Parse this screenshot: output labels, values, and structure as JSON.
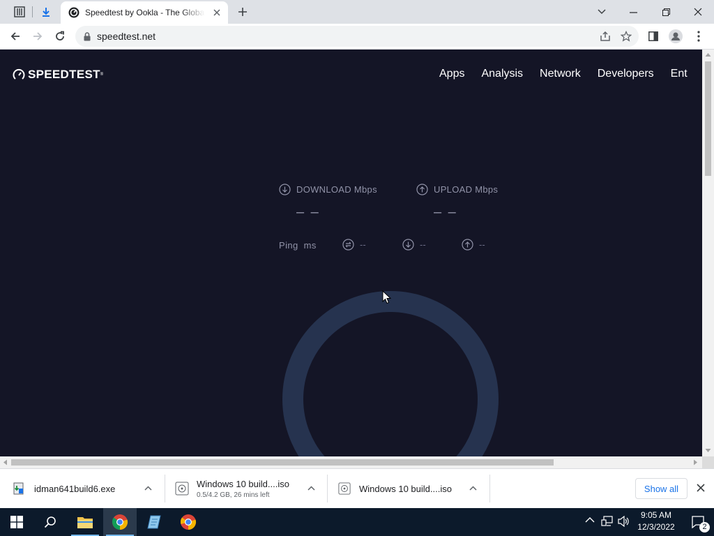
{
  "browser": {
    "tab_title": "Speedtest by Ookla - The Global Broadband Speed Test",
    "url": "speedtest.net"
  },
  "site": {
    "logo_text": "SPEEDTEST",
    "nav": [
      "Apps",
      "Analysis",
      "Network",
      "Developers",
      "Ent"
    ],
    "download": {
      "label": "DOWNLOAD",
      "unit": "Mbps",
      "value": "– –"
    },
    "upload": {
      "label": "UPLOAD",
      "unit": "Mbps",
      "value": "– –"
    },
    "ping": {
      "label": "Ping",
      "unit": "ms",
      "idle": "--",
      "download": "--",
      "upload": "--"
    },
    "colors": {
      "background": "#141526",
      "gauge_ring": "#26334f",
      "text_muted": "#9193a8"
    }
  },
  "downloads": [
    {
      "name": "idman641build6.exe",
      "sub": ""
    },
    {
      "name": "Windows 10 build....iso",
      "sub": "0.5/4.2 GB, 26 mins left"
    },
    {
      "name": "Windows 10 build....iso",
      "sub": ""
    }
  ],
  "shelf": {
    "show_all": "Show all"
  },
  "taskbar": {
    "time": "9:05 AM",
    "date": "12/3/2022",
    "notification_count": "2"
  }
}
